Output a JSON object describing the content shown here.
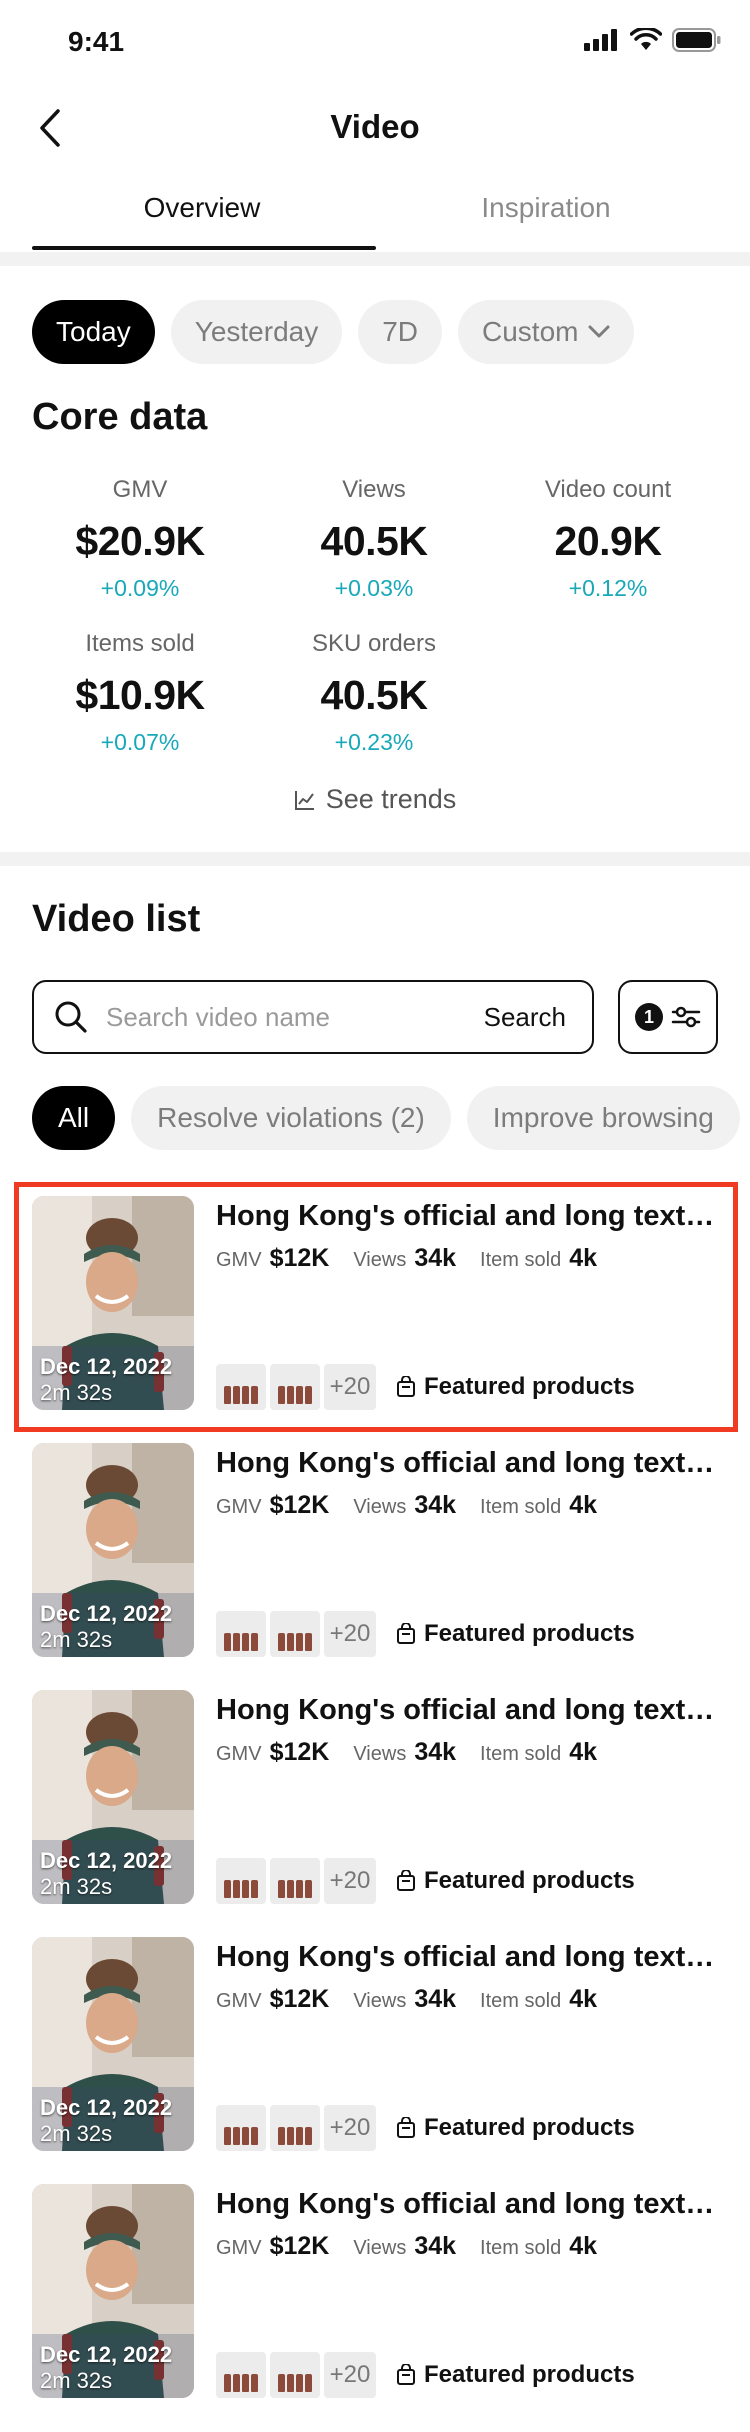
{
  "status_bar": {
    "time": "9:41"
  },
  "nav": {
    "title": "Video"
  },
  "tabs": [
    {
      "label": "Overview"
    },
    {
      "label": "Inspiration"
    }
  ],
  "date_chips": [
    {
      "label": "Today"
    },
    {
      "label": "Yesterday"
    },
    {
      "label": "7D"
    },
    {
      "label": "Custom"
    }
  ],
  "core_data": {
    "title": "Core data",
    "metrics": [
      {
        "label": "GMV",
        "value": "$20.9K",
        "delta": "+0.09%"
      },
      {
        "label": "Views",
        "value": "40.5K",
        "delta": "+0.03%"
      },
      {
        "label": "Video count",
        "value": "20.9K",
        "delta": "+0.12%"
      },
      {
        "label": "Items sold",
        "value": "$10.9K",
        "delta": "+0.07%"
      },
      {
        "label": "SKU orders",
        "value": "40.5K",
        "delta": "+0.23%"
      }
    ],
    "see_trends": "See trends"
  },
  "video_list": {
    "title": "Video list",
    "search": {
      "placeholder": "Search video name",
      "button": "Search"
    },
    "filter_count": "1",
    "status_chips": [
      {
        "label": "All"
      },
      {
        "label": "Resolve violations (2)"
      },
      {
        "label": "Improve browsing"
      }
    ],
    "items": [
      {
        "title": "Hong Kong's official and long text title",
        "date": "Dec 12, 2022",
        "duration": "2m 32s",
        "gmv_label": "GMV",
        "gmv": "$12K",
        "views_label": "Views",
        "views": "34k",
        "sold_label": "Item sold",
        "sold": "4k",
        "more_products": "+20",
        "featured": "Featured products"
      },
      {
        "title": "Hong Kong's official and long text title",
        "date": "Dec 12, 2022",
        "duration": "2m 32s",
        "gmv_label": "GMV",
        "gmv": "$12K",
        "views_label": "Views",
        "views": "34k",
        "sold_label": "Item sold",
        "sold": "4k",
        "more_products": "+20",
        "featured": "Featured products"
      },
      {
        "title": "Hong Kong's official and long text title",
        "date": "Dec 12, 2022",
        "duration": "2m 32s",
        "gmv_label": "GMV",
        "gmv": "$12K",
        "views_label": "Views",
        "views": "34k",
        "sold_label": "Item sold",
        "sold": "4k",
        "more_products": "+20",
        "featured": "Featured products"
      },
      {
        "title": "Hong Kong's official and long text title",
        "date": "Dec 12, 2022",
        "duration": "2m 32s",
        "gmv_label": "GMV",
        "gmv": "$12K",
        "views_label": "Views",
        "views": "34k",
        "sold_label": "Item sold",
        "sold": "4k",
        "more_products": "+20",
        "featured": "Featured products"
      },
      {
        "title": "Hong Kong's official and long text title",
        "date": "Dec 12, 2022",
        "duration": "2m 32s",
        "gmv_label": "GMV",
        "gmv": "$12K",
        "views_label": "Views",
        "views": "34k",
        "sold_label": "Item sold",
        "sold": "4k",
        "more_products": "+20",
        "featured": "Featured products"
      }
    ]
  },
  "colors": {
    "accent_delta": "#18a9b9",
    "highlight": "#f03a21",
    "primary": "#000000"
  },
  "icons": [
    "signal-icon",
    "wifi-icon",
    "battery-icon",
    "back-arrow-icon",
    "chevron-down-icon",
    "trend-chart-icon",
    "search-icon",
    "filter-icon",
    "shopping-bag-icon"
  ]
}
